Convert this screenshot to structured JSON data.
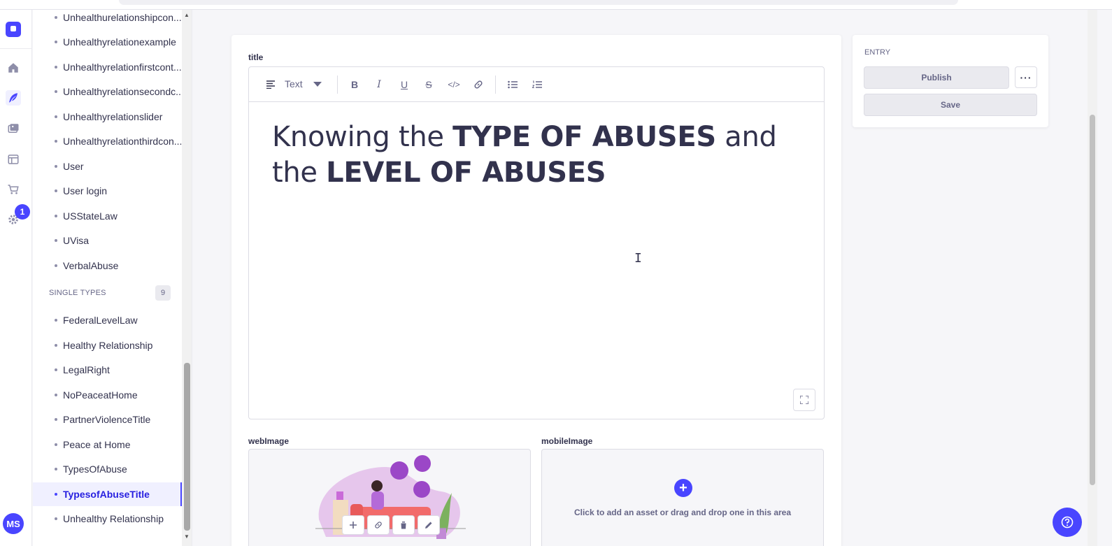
{
  "rail": {
    "badge_count": "1",
    "avatar_initials": "MS",
    "icons": [
      "logo-icon",
      "home-icon",
      "content-manager-icon",
      "media-library-icon",
      "content-type-builder-icon",
      "marketplace-icon",
      "settings-icon"
    ]
  },
  "nav": {
    "collection_items": [
      "Unhealthurelationshipcon...",
      "Unhealthyrelationexample",
      "Unhealthyrelationfirstcont...",
      "Unhealthyrelationsecondc...",
      "Unhealthyrelationslider",
      "Unhealthyrelationthirdcon...",
      "User",
      "User login",
      "USStateLaw",
      "UVisa",
      "VerbalAbuse"
    ],
    "single_types_label": "SINGLE TYPES",
    "single_types_count": "9",
    "single_items": [
      "FederalLevelLaw",
      "Healthy Relationship",
      "LegalRight",
      "NoPeaceatHome",
      "PartnerViolenceTitle",
      "Peace at Home",
      "TypesOfAbuse",
      "TypesofAbuseTitle",
      "Unhealthy Relationship"
    ],
    "active_item": "TypesofAbuseTitle"
  },
  "editor": {
    "field_label": "title",
    "block_type": "Text",
    "heading_parts": {
      "p1": "Knowing the ",
      "b1": "TYPE OF ABUSES",
      "p2": " and the ",
      "b2": "LEVEL OF ABUSES"
    }
  },
  "web_image": {
    "label": "webImage"
  },
  "mobile_image": {
    "label": "mobileImage",
    "hint": "Click to add an asset or drag and drop one in this area"
  },
  "entry_panel": {
    "title": "ENTRY",
    "publish_label": "Publish",
    "save_label": "Save",
    "more_label": "···"
  },
  "colors": {
    "accent": "#4945ff",
    "active_bg": "#f0f0ff",
    "text": "#32324d",
    "muted": "#666687"
  }
}
